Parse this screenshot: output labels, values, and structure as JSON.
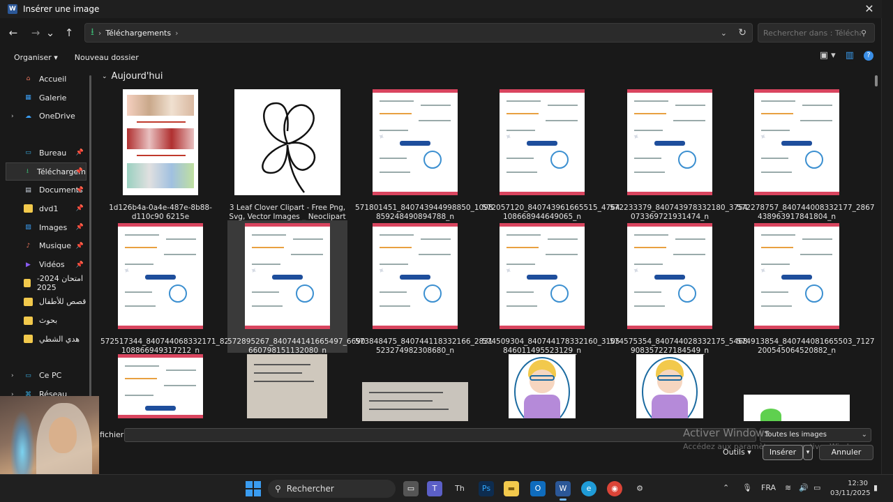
{
  "window": {
    "title": "Insérer une image",
    "app_icon": "W"
  },
  "nav": {
    "back": "←",
    "forward": "→",
    "recent": "⌄",
    "up": "↑",
    "breadcrumb": [
      "Téléchargements"
    ],
    "search_placeholder": "Rechercher dans : Télécharg..."
  },
  "toolbar": {
    "organize": "Organiser ▾",
    "new_folder": "Nouveau dossier"
  },
  "sidebar": {
    "items": [
      {
        "label": "Accueil",
        "icon": "home-icon",
        "color": "#e8745c"
      },
      {
        "label": "Galerie",
        "icon": "gallery-icon",
        "color": "#3a9cf0"
      },
      {
        "label": "OneDrive",
        "icon": "cloud-icon",
        "color": "#3a9cf0",
        "expand": true
      },
      {
        "label": "Bureau",
        "icon": "desktop-icon",
        "color": "#3ab0e6",
        "pinned": true
      },
      {
        "label": "Téléchargem",
        "icon": "download-icon",
        "color": "#3cb371",
        "pinned": true,
        "active": true
      },
      {
        "label": "Documents",
        "icon": "document-icon",
        "color": "#cfd8e3",
        "pinned": true
      },
      {
        "label": "dvd1",
        "icon": "folder-icon",
        "color": "#f2c94c",
        "pinned": true
      },
      {
        "label": "Images",
        "icon": "pictures-icon",
        "color": "#3a9cf0",
        "pinned": true
      },
      {
        "label": "Musique",
        "icon": "music-icon",
        "color": "#e8745c",
        "pinned": true
      },
      {
        "label": "Vidéos",
        "icon": "video-icon",
        "color": "#8a5cf0",
        "pinned": true
      },
      {
        "label": "امتحان 2024-2025",
        "icon": "folder-icon",
        "color": "#f2c94c"
      },
      {
        "label": "قصص للأطفال",
        "icon": "folder-icon",
        "color": "#f2c94c"
      },
      {
        "label": "بحوث",
        "icon": "folder-icon",
        "color": "#f2c94c"
      },
      {
        "label": "هدي الشطي",
        "icon": "folder-icon",
        "color": "#f2c94c"
      },
      {
        "label": "Ce PC",
        "icon": "computer-icon",
        "color": "#3ab0e6",
        "expand": true
      },
      {
        "label": "Réseau",
        "icon": "network-icon",
        "color": "#3ab0e6",
        "expand": true
      }
    ]
  },
  "content": {
    "group": "Aujourd'hui",
    "files": [
      {
        "name": "1d126b4a-0a4e-487e-8b88-d110c90 6215e",
        "kind": "collage"
      },
      {
        "name": "3 Leaf Clover Clipart - Free Png, Svg, Vector Images _ Neoclipart",
        "kind": "clover"
      },
      {
        "name": "571801451_840743944998850_1098 859248490894788_n",
        "kind": "doc"
      },
      {
        "name": "572057120_840743961665515_4764 108668944649065_n",
        "kind": "doc"
      },
      {
        "name": "572233379_840743978332180_3754 073369721931474_n",
        "kind": "doc"
      },
      {
        "name": "572278757_840744008332177_2867 438963917841804_n",
        "kind": "doc"
      },
      {
        "name": "572517344_840744068332171_8205 108866949317212_n",
        "kind": "doc"
      },
      {
        "name": "572895267_840744141665497_6690 660798151132080_n",
        "kind": "doc",
        "selected": true
      },
      {
        "name": "573848475_840744118332166_2831 523274982308680_n",
        "kind": "doc"
      },
      {
        "name": "574509304_840744178332160_3105 846011495523129_n",
        "kind": "doc"
      },
      {
        "name": "574575354_840744028332175_5468 908357227184549_n",
        "kind": "doc"
      },
      {
        "name": "574913854_840744081665503_7127 200545064520882_n",
        "kind": "doc"
      },
      {
        "name": "",
        "kind": "doc"
      },
      {
        "name": "",
        "kind": "paper"
      },
      {
        "name": "",
        "kind": "paper2"
      },
      {
        "name": "",
        "kind": "kid"
      },
      {
        "name": "",
        "kind": "kid"
      },
      {
        "name": "",
        "kind": "bug"
      }
    ]
  },
  "footer": {
    "filename_label": "fichier :",
    "filename_value": "",
    "filter": "Toutes les images",
    "tools": "Outils ▾",
    "insert": "Insérer",
    "cancel": "Annuler",
    "activation_title": "Activer Windows",
    "activation_sub": "Accédez aux paramètres pour activer Windows."
  },
  "taskbar": {
    "search": "Rechercher",
    "lang": "FRA",
    "time": "12:30",
    "date": "03/11/2025"
  }
}
